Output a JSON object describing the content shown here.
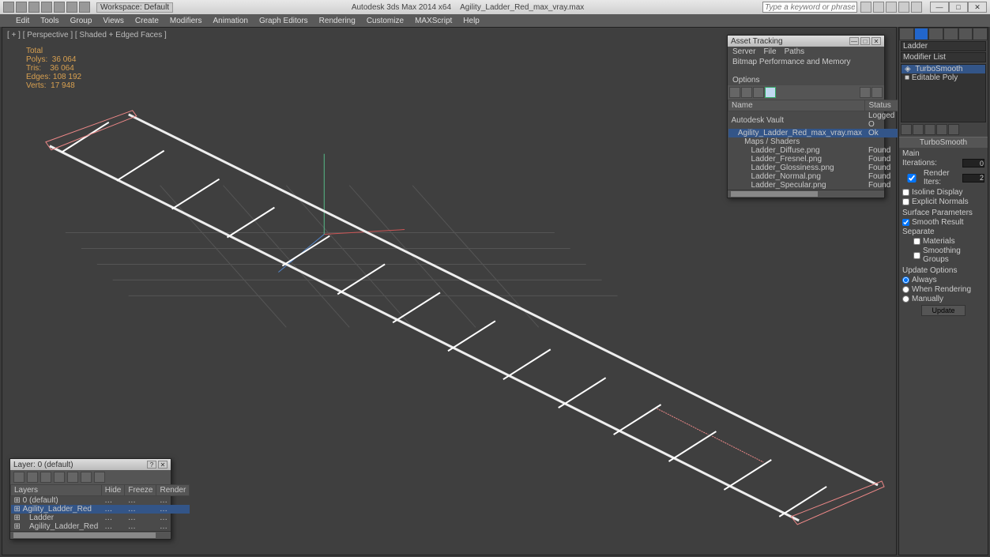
{
  "app": {
    "title_left": "Autodesk 3ds Max 2014 x64",
    "title_file": "Agility_Ladder_Red_max_vray.max",
    "workspace_label": "Workspace: Default",
    "search_placeholder": "Type a keyword or phrase"
  },
  "menu": [
    "Edit",
    "Tools",
    "Group",
    "Views",
    "Create",
    "Modifiers",
    "Animation",
    "Graph Editors",
    "Rendering",
    "Customize",
    "MAXScript",
    "Help"
  ],
  "viewport": {
    "label": "[ + ] [ Perspective ] [ Shaded + Edged Faces ]",
    "stats": {
      "heading": "Total",
      "polys_label": "Polys:",
      "polys": "36 064",
      "tris_label": "Tris:",
      "tris": "36 064",
      "edges_label": "Edges:",
      "edges": "108 192",
      "verts_label": "Verts:",
      "verts": "17 948"
    }
  },
  "cmd": {
    "object_name": "Ladder",
    "modifier_list_label": "Modifier List",
    "stack": {
      "item0": "TurboSmooth",
      "item1": "Editable Poly"
    },
    "rollout": {
      "title": "TurboSmooth",
      "main_label": "Main",
      "iterations_label": "Iterations:",
      "iterations": "0",
      "render_iters_label": "Render Iters:",
      "render_iters": "2",
      "isoline_label": "Isoline Display",
      "explicit_label": "Explicit Normals",
      "surface_label": "Surface Parameters",
      "smooth_result_label": "Smooth Result",
      "separate_label": "Separate",
      "materials_label": "Materials",
      "smgroups_label": "Smoothing Groups",
      "update_label": "Update Options",
      "always_label": "Always",
      "when_rendering_label": "When Rendering",
      "manually_label": "Manually",
      "update_btn": "Update"
    }
  },
  "asset": {
    "title": "Asset Tracking",
    "menu1": [
      "Server",
      "File",
      "Paths"
    ],
    "menu2": [
      "Bitmap Performance and Memory",
      "Options"
    ],
    "cols": {
      "name": "Name",
      "status": "Status"
    },
    "rows": [
      {
        "name": "Autodesk Vault",
        "status": "Logged O",
        "indent": 0
      },
      {
        "name": "Agility_Ladder_Red_max_vray.max",
        "status": "Ok",
        "indent": 1,
        "sel": true
      },
      {
        "name": "Maps / Shaders",
        "status": "",
        "indent": 2
      },
      {
        "name": "Ladder_Diffuse.png",
        "status": "Found",
        "indent": 3
      },
      {
        "name": "Ladder_Fresnel.png",
        "status": "Found",
        "indent": 3
      },
      {
        "name": "Ladder_Glossiness.png",
        "status": "Found",
        "indent": 3
      },
      {
        "name": "Ladder_Normal.png",
        "status": "Found",
        "indent": 3
      },
      {
        "name": "Ladder_Specular.png",
        "status": "Found",
        "indent": 3
      }
    ]
  },
  "layers": {
    "title": "Layer: 0 (default)",
    "cols": {
      "layers": "Layers",
      "hide": "Hide",
      "freeze": "Freeze",
      "render": "Render"
    },
    "rows": [
      {
        "name": "0 (default)",
        "indent": 0
      },
      {
        "name": "Agility_Ladder_Red",
        "indent": 0,
        "sel": true
      },
      {
        "name": "Ladder",
        "indent": 1
      },
      {
        "name": "Agility_Ladder_Red",
        "indent": 1
      }
    ]
  }
}
